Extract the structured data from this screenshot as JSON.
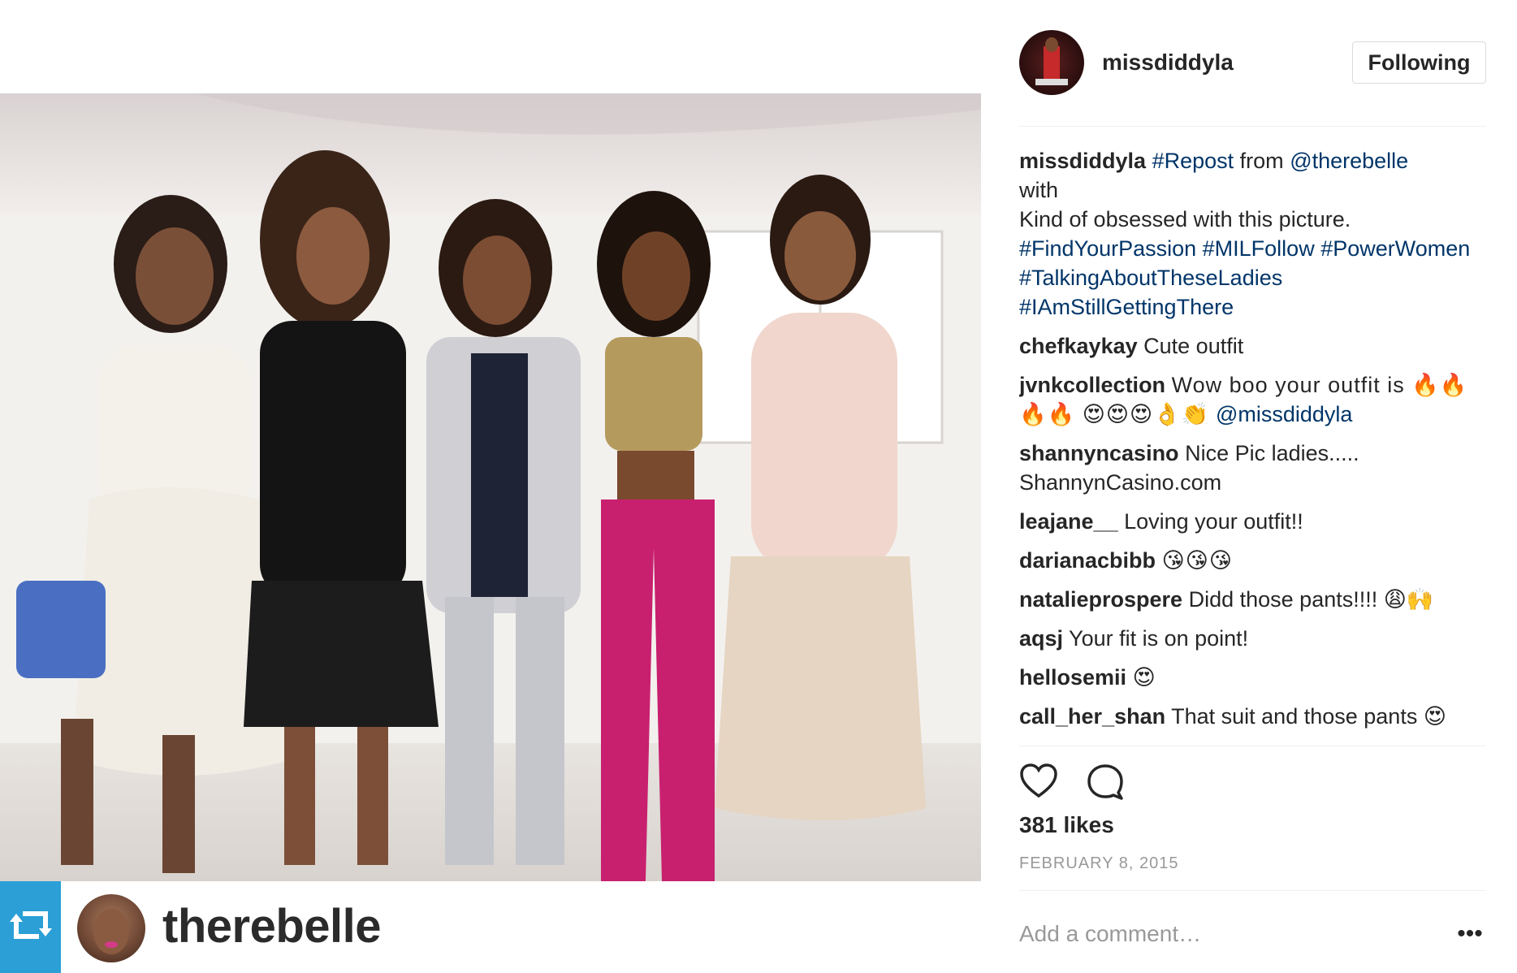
{
  "post": {
    "repost_username": "therebelle",
    "repost_badge_icon": "repost-icon",
    "photo_alt": "photo"
  },
  "header": {
    "username": "missdiddyla",
    "follow_label": "Following"
  },
  "caption": {
    "user": "missdiddyla",
    "parts": {
      "tag_repost": "#Repost",
      "from": "from",
      "mention": "@therebelle",
      "with": "with",
      "line2": "Kind of obsessed with this picture.",
      "hashtags": "#FindYourPassion #MILFollow #PowerWomen #TalkingAboutTheseLadies #IAmStillGettingThere"
    }
  },
  "comments": [
    {
      "user": "chefkaykay",
      "text": "Cute outfit"
    },
    {
      "user": "jvnkcollection",
      "text": "Wow boo your outfit is 🔥🔥🔥🔥 😍😍😍👌👏",
      "mention": "@missdiddyla"
    },
    {
      "user": "shannyncasino",
      "text": "Nice Pic ladies..... ShannynCasino.com"
    },
    {
      "user": "leajane__",
      "text": "Loving your outfit!!"
    },
    {
      "user": "darianacbibb",
      "text": "😘😘😘"
    },
    {
      "user": "natalieprospere",
      "text": "Didd those pants!!!! 😩🙌"
    },
    {
      "user": "aqsj",
      "text": "Your fit is on point!"
    },
    {
      "user": "hellosemii",
      "text": "😍"
    },
    {
      "user": "call_her_shan",
      "text": "That suit and those pants 😍"
    }
  ],
  "actions": {
    "like_icon": "heart-icon",
    "comment_icon": "comment-icon"
  },
  "likes_text": "381 likes",
  "date_text": "FEBRUARY 8, 2015",
  "comment_box": {
    "placeholder": "Add a comment…",
    "more_label": "•••"
  },
  "colors": {
    "link": "#003569",
    "repost_badge": "#2b9fd6",
    "muted": "#999999"
  }
}
